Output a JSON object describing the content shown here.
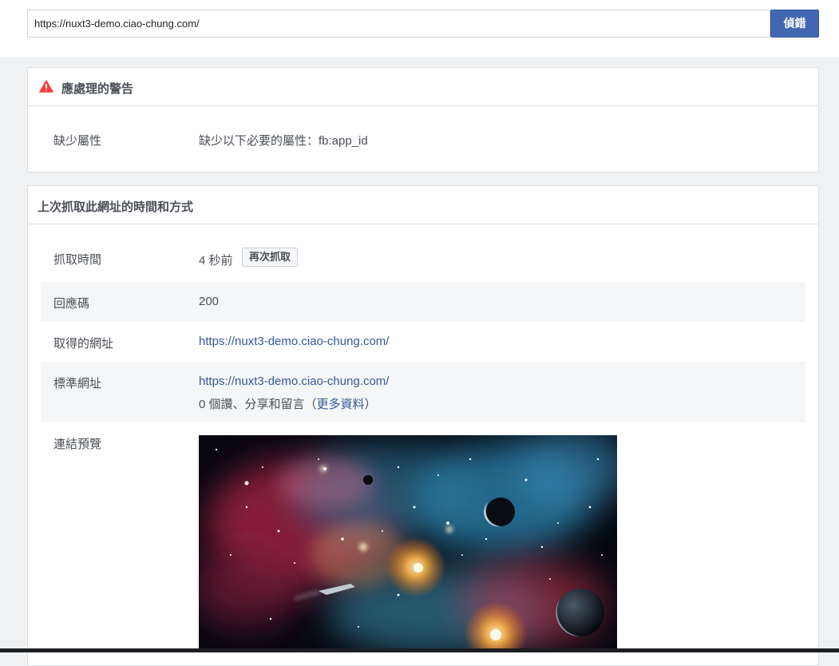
{
  "search": {
    "url_value": "https://nuxt3-demo.ciao-chung.com/",
    "debug_button_label": "偵錯"
  },
  "warnings_panel": {
    "title": "應處理的警告",
    "icon": "warning-triangle-icon",
    "icon_color": "#fa3e3e",
    "rows": [
      {
        "label": "缺少屬性",
        "value": "缺少以下必要的屬性：fb:app_id"
      }
    ]
  },
  "scrape_panel": {
    "title": "上次抓取此網址的時間和方式",
    "fetch_time": {
      "label": "抓取時間",
      "value": "4 秒前",
      "rescrape_label": "再次抓取"
    },
    "response_code": {
      "label": "回應碼",
      "value": "200"
    },
    "fetched_url": {
      "label": "取得的網址",
      "value": "https://nuxt3-demo.ciao-chung.com/"
    },
    "canonical_url": {
      "label": "標準網址",
      "value": "https://nuxt3-demo.ciao-chung.com/",
      "engagement_prefix": "0 個讚、分享和留言（",
      "more_info_label": "更多資料",
      "engagement_suffix": "）"
    },
    "link_preview": {
      "label": "連結預覽",
      "image": "space-nebula-image"
    }
  },
  "colors": {
    "primary_button": "#4267b2",
    "link": "#365899",
    "text": "#4b4f56",
    "page_bg": "#f0f1f3",
    "row_shade": "#f5f6f7"
  }
}
